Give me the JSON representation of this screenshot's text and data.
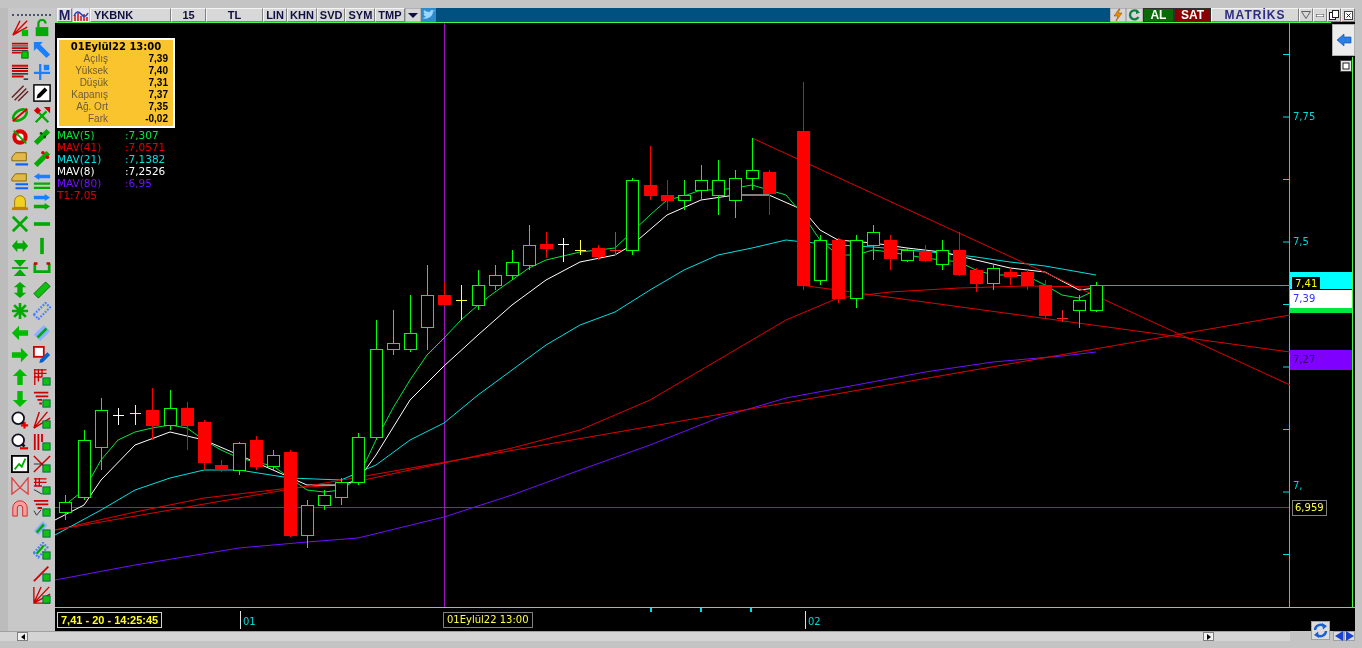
{
  "toolbar": {
    "logo_letter": "M",
    "symbol": "YKBNK",
    "period": "15",
    "currency": "TL",
    "buttons": [
      "LIN",
      "KHN",
      "SVD",
      "SYM",
      "TMP"
    ],
    "trade_buttons": [
      {
        "label": "AL",
        "kind": "buy"
      },
      {
        "label": "SAT",
        "kind": "sell"
      }
    ],
    "brand": "MATRİKS"
  },
  "info_box": {
    "title": "01Eylül22 13:00",
    "rows": [
      {
        "label": "Açılış",
        "value": "7,39"
      },
      {
        "label": "Yüksek",
        "value": "7,40"
      },
      {
        "label": "Düşük",
        "value": "7,31"
      },
      {
        "label": "Kapanış",
        "value": "7,37"
      },
      {
        "label": "Ağ. Ort",
        "value": "7,35"
      },
      {
        "label": "Fark",
        "value": "-0,02"
      }
    ]
  },
  "legend": [
    {
      "label": "MAV(5)",
      "value": ":7,307",
      "color": "#00e83c"
    },
    {
      "label": "MAV(41)",
      "value": ":7,0571",
      "color": "#e00000"
    },
    {
      "label": "MAV(21)",
      "value": ":7,1382",
      "color": "#00e0e0"
    },
    {
      "label": "MAV(8)",
      "value": ":7,2526",
      "color": "#ffffff"
    },
    {
      "label": "MAV(80)",
      "value": ":6,95",
      "color": "#7010ff"
    },
    {
      "label": "T1:7,05",
      "color": "#e00000"
    }
  ],
  "price_axis": {
    "ticks": [
      "7,75",
      "7,5",
      "7,"
    ],
    "markers": [
      {
        "text": "7,41",
        "kind": "last",
        "color": "#00ffff"
      },
      {
        "text": "7,39",
        "kind": "band",
        "color": "#ffffff"
      },
      {
        "text": "7,27",
        "kind": "band",
        "color": "#8000ff"
      }
    ],
    "crosshair_price": "6,959"
  },
  "time_axis": {
    "readout": "7,41 - 20 - 14:25:45",
    "day_labels": [
      "01",
      "02"
    ],
    "crosshair_time": "01Eylül22 13:00"
  }
}
